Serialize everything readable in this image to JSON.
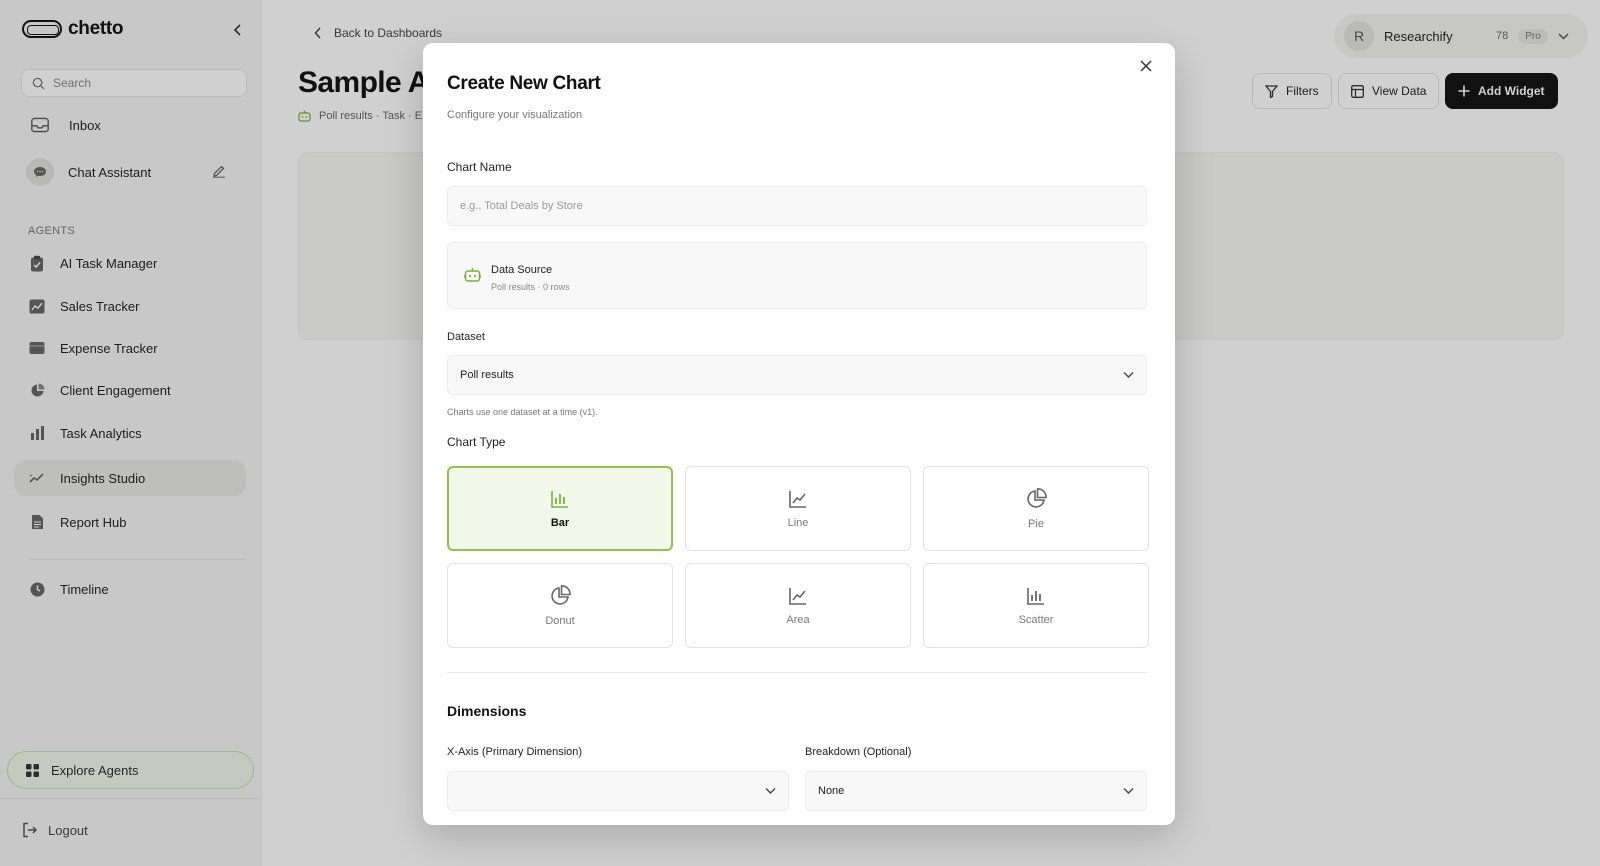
{
  "sidebar": {
    "logo_text": "chetto",
    "search_placeholder": "Search",
    "inbox_label": "Inbox",
    "chat_label": "Chat Assistant",
    "agents_section_label": "AGENTS",
    "agents": [
      {
        "label": "AI Task Manager",
        "icon": "clipboard-icon"
      },
      {
        "label": "Sales Tracker",
        "icon": "chart-line-icon"
      },
      {
        "label": "Expense Tracker",
        "icon": "wallet-icon"
      },
      {
        "label": "Client Engagement",
        "icon": "pie-icon"
      },
      {
        "label": "Task Analytics",
        "icon": "bar-chart-icon"
      },
      {
        "label": "Insights Studio",
        "icon": "trend-icon"
      },
      {
        "label": "Report Hub",
        "icon": "document-icon"
      }
    ],
    "timeline_label": "Timeline",
    "explore_label": "Explore Agents",
    "logout_label": "Logout"
  },
  "header": {
    "back_label": "Back to Dashboards",
    "page_title": "Sample An",
    "page_meta": "Poll results · Task · E",
    "user": {
      "initial": "R",
      "name": "Researchify",
      "credits": "78",
      "plan": "Pro"
    },
    "filters_label": "Filters",
    "view_data_label": "View Data",
    "add_widget_label": "Add Widget"
  },
  "modal": {
    "title": "Create New Chart",
    "subtitle": "Configure your visualization",
    "chart_name_label": "Chart Name",
    "chart_name_placeholder": "e.g., Total Deals by Store",
    "data_source_title": "Data Source",
    "data_source_sub": "Poll results · 0 rows",
    "dataset_label": "Dataset",
    "dataset_value": "Poll results",
    "dataset_hint": "Charts use one dataset at a time (v1).",
    "chart_type_label": "Chart Type",
    "chart_types": [
      {
        "label": "Bar",
        "icon": "bar-chart-icon",
        "selected": true
      },
      {
        "label": "Line",
        "icon": "line-chart-icon",
        "selected": false
      },
      {
        "label": "Pie",
        "icon": "pie-chart-icon",
        "selected": false
      },
      {
        "label": "Donut",
        "icon": "donut-chart-icon",
        "selected": false
      },
      {
        "label": "Area",
        "icon": "area-chart-icon",
        "selected": false
      },
      {
        "label": "Scatter",
        "icon": "scatter-chart-icon",
        "selected": false
      }
    ],
    "dimensions_title": "Dimensions",
    "x_axis_label": "X-Axis (Primary Dimension)",
    "x_axis_value": "",
    "breakdown_label": "Breakdown (Optional)",
    "breakdown_value": "None"
  },
  "colors": {
    "accent": "#92c24e",
    "accent_bg": "#f2f8e9",
    "primary_button": "#111111"
  }
}
